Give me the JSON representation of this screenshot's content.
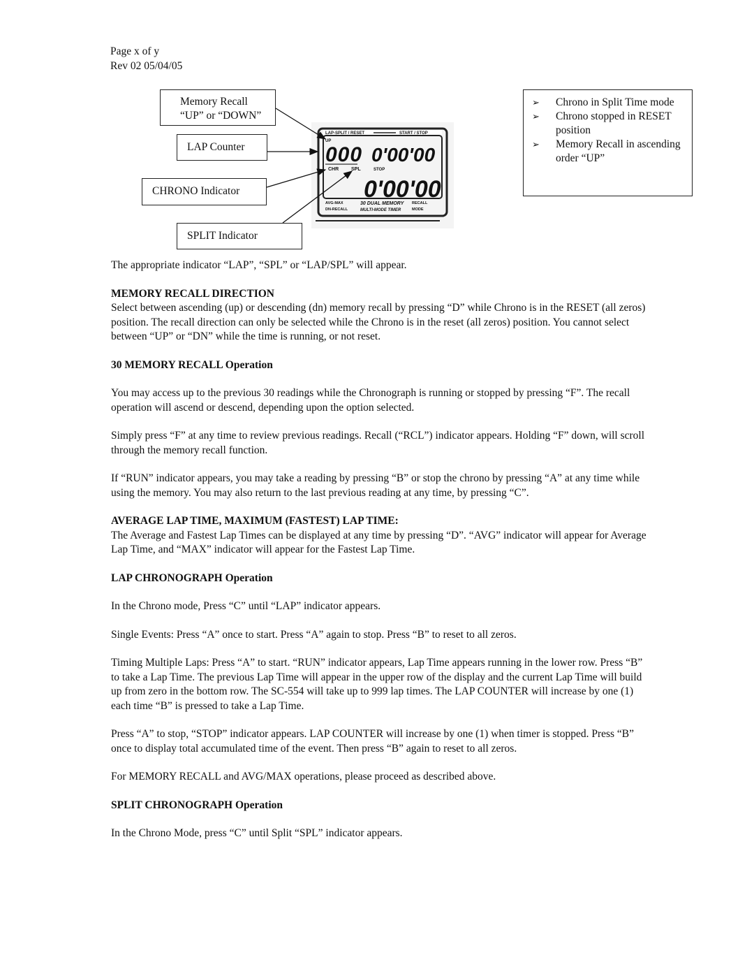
{
  "header": {
    "page": "Page x of y",
    "revision": "Rev 02 05/04/05"
  },
  "diagram": {
    "callouts": {
      "memory_recall": [
        "Memory Recall",
        "“UP” or “DOWN”"
      ],
      "lap_counter": "LAP Counter",
      "chrono_indicator": "CHRONO Indicator",
      "split_indicator": "SPLIT Indicator"
    },
    "lcd": {
      "top_label_left": "LAP-SPLIT / RESET",
      "top_label_right": "START / STOP",
      "up_indicator": "UP",
      "lap_count": "000",
      "upper_time": "0'00'00",
      "lower_time": "0'00'00",
      "chr_label": "CHR",
      "spl_label": "SPL",
      "stop_label": "STOP",
      "bottom_left_1": "AVG-MAX",
      "bottom_left_2": "DN-RECALL",
      "bottom_center_1": "30 DUAL MEMORY",
      "bottom_center_2": "MULTI-MODE TIMER",
      "bottom_right_1": "RECALL",
      "bottom_right_2": "MODE"
    },
    "status_box": {
      "bullet_icon": "arrowhead-bullet",
      "items": [
        "Chrono in Split Time mode",
        "Chrono stopped in RESET position",
        "Memory Recall in ascending order “UP”"
      ]
    }
  },
  "body": {
    "intro": "The appropriate indicator “LAP”, “SPL” or “LAP/SPL” will appear.",
    "sections": [
      {
        "heading": "MEMORY RECALL DIRECTION",
        "paragraphs": [
          "Select between ascending (up) or descending (dn) memory recall by pressing “D” while Chrono is in the RESET (all zeros) position.  The recall direction can only be selected while the Chrono is in the reset (all zeros) position.  You cannot select between “UP” or “DN” while the time is running, or not reset."
        ]
      },
      {
        "heading": "30 MEMORY RECALL Operation",
        "paragraphs": [
          "You may access up to the previous 30 readings while the Chronograph is running or stopped by pressing “F”.  The recall operation will ascend or descend, depending upon the option selected.",
          "Simply press “F” at any time to review previous readings.  Recall (“RCL”) indicator appears.  Holding “F” down, will scroll through the memory recall function.",
          "If “RUN” indicator appears, you may take a reading by pressing “B” or stop the chrono by pressing “A” at any time while using the memory.  You may also return to the last previous reading at any time, by pressing “C”."
        ]
      },
      {
        "heading": "AVERAGE LAP TIME, MAXIMUM (FASTEST) LAP TIME:",
        "paragraphs": [
          "The Average and Fastest Lap Times can be displayed at any time by pressing “D”.  “AVG” indicator will appear for Average Lap Time, and “MAX” indicator will appear for the Fastest Lap Time."
        ]
      },
      {
        "heading": "LAP CHRONOGRAPH Operation",
        "paragraphs": [
          "In the Chrono mode, Press “C” until “LAP” indicator appears.",
          "Single Events:  Press “A” once to start.  Press “A” again to stop.  Press “B” to reset to all zeros.",
          "Timing Multiple Laps:  Press “A” to start.  “RUN” indicator appears,  Lap Time appears running in the lower row.  Press “B” to take a Lap Time.  The previous Lap Time will appear in the upper row of the display and the current Lap Time will build up from zero in the bottom row.   The SC-554 will take up to 999 lap times. The LAP COUNTER will  increase by one (1) each time “B” is pressed to take a Lap Time.",
          "Press “A” to stop, “STOP” indicator appears.  LAP COUNTER will increase by one (1) when timer is stopped.  Press “B” once to display total accumulated time of the event.  Then press “B” again to reset to all zeros.",
          "For MEMORY RECALL and AVG/MAX operations, please proceed as described above."
        ]
      },
      {
        "heading": "SPLIT CHRONOGRAPH Operation",
        "paragraphs": [
          "In the Chrono Mode, press “C” until Split “SPL” indicator appears."
        ]
      }
    ]
  }
}
